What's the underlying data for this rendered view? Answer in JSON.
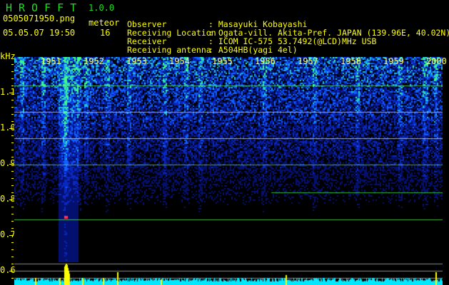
{
  "header": {
    "app_title": "HROFFT",
    "version": "1.0.0",
    "filename": "0505071950.png",
    "datetime": "05.05.07 19:50",
    "meteor_label": "meteor",
    "meteor_count": "16"
  },
  "info": [
    {
      "label": "Observer",
      "value": "Masayuki Kobayashi"
    },
    {
      "label": "Receiving Location",
      "value": "Ogata-vill. Akita-Pref. JAPAN (139.96E, 40.02N)"
    },
    {
      "label": "Receiver",
      "value": "ICOM IC-575 53.7492(@LCD)MHz USB"
    },
    {
      "label": "Receiving antenna",
      "value": "A504HB(yagi 4el)"
    }
  ],
  "axis": {
    "unit": "kHz",
    "y_labels": [
      "1.1",
      "1.0",
      "0.9",
      "0.8",
      "0.7",
      "0.6"
    ],
    "time_labels": [
      "1951",
      "1952",
      "1953",
      "1954",
      "1955",
      "1956",
      "1957",
      "1958",
      "1959",
      "2000"
    ]
  },
  "colors": {
    "text": "#ffff00",
    "title": "#22dd22",
    "noise_floor": "#00ffff",
    "meteor_bar": "#ffff00"
  }
}
